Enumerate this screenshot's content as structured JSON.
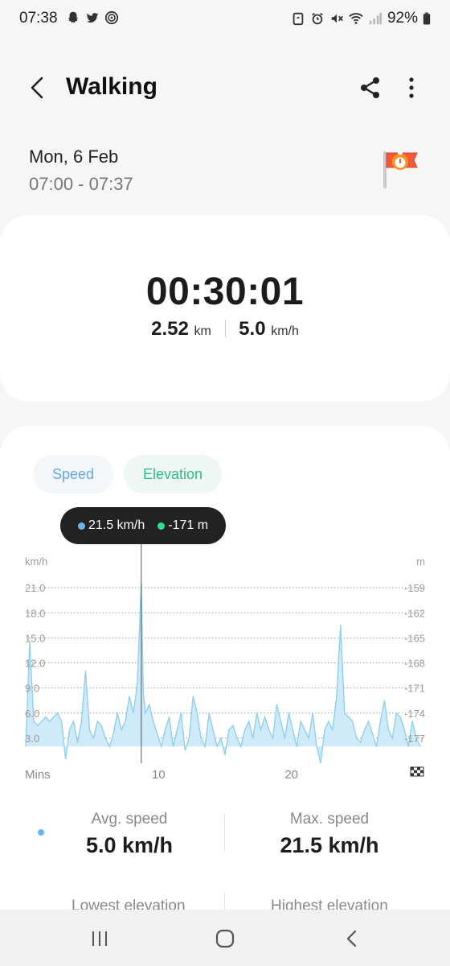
{
  "status_bar": {
    "time": "07:38",
    "battery": "92%",
    "left_icons": [
      "snapchat-icon",
      "twitter-icon",
      "nfc-icon"
    ],
    "right_icons": [
      "recycle-icon",
      "alarm-icon",
      "mute-icon",
      "wifi-icon",
      "signal-icon",
      "battery-icon"
    ]
  },
  "app_bar": {
    "title": "Walking"
  },
  "session": {
    "date": "Mon, 6 Feb",
    "time_range": "07:00 - 07:37"
  },
  "summary": {
    "duration": "00:30:01",
    "distance_value": "2.52",
    "distance_unit": "km",
    "speed_value": "5.0",
    "speed_unit": "km/h"
  },
  "chart_tabs": {
    "speed": "Speed",
    "elevation": "Elevation"
  },
  "tooltip": {
    "speed": "21.5 km/h",
    "elevation": "-171 m"
  },
  "colors": {
    "speed": "#6ab4ef",
    "speed_fill": "#cfeaf8",
    "elevation": "#2fbd85",
    "card": "#ffffff",
    "background": "#f6f6f6"
  },
  "chart_data": {
    "type": "area",
    "title": "",
    "left_axis_label": "km/h",
    "right_axis_label": "m",
    "left_ticks": [
      "21.0",
      "18.0",
      "15.0",
      "12.0",
      "9.0",
      "6.0",
      "3.0"
    ],
    "right_ticks": [
      "-159",
      "-162",
      "-165",
      "-168",
      "-171",
      "-174",
      "-177"
    ],
    "x_label": "Mins",
    "x_ticks": [
      "10",
      "20"
    ],
    "xlim": [
      0,
      30
    ],
    "ylim": [
      0,
      24
    ],
    "series": [
      {
        "values_x": [
          0,
          0.3,
          0.6,
          0.9,
          1.2,
          1.5,
          1.8,
          2.1,
          2.4,
          2.7,
          3.0,
          3.3,
          3.6,
          3.9,
          4.2,
          4.5,
          4.8,
          5.1,
          5.4,
          5.7,
          6.0,
          6.3,
          6.6,
          6.9,
          7.2,
          7.5,
          7.8,
          8.1,
          8.4,
          8.7,
          8.85,
          9.0,
          9.3,
          9.6,
          9.9,
          10.2,
          10.5,
          10.8,
          11.1,
          11.4,
          11.7,
          12.0,
          12.3,
          12.6,
          12.9,
          13.2,
          13.5,
          13.8,
          14.1,
          14.4,
          14.7,
          15.0,
          15.3,
          15.6,
          15.9,
          16.2,
          16.5,
          16.8,
          17.1,
          17.4,
          17.7,
          18.0,
          18.3,
          18.6,
          18.9,
          19.2,
          19.5,
          19.8,
          20.1,
          20.4,
          20.7,
          21.0,
          21.3,
          21.6,
          21.9,
          22.2,
          22.5,
          22.8,
          23.1,
          23.4,
          23.7,
          24.0,
          24.3,
          24.6,
          24.9,
          25.2,
          25.5,
          25.8,
          26.1,
          26.4,
          26.7,
          27.0,
          27.3,
          27.6,
          27.9,
          28.2,
          28.5,
          28.8,
          29.1,
          29.4,
          29.7,
          30.0
        ],
        "values_y": [
          2,
          14.5,
          5,
          4.5,
          5,
          5.5,
          5,
          5.5,
          6,
          5,
          0.5,
          4,
          5,
          2.5,
          5,
          11,
          4,
          3,
          5,
          4.5,
          3,
          2,
          3.5,
          6,
          4,
          5,
          8,
          6,
          9.5,
          21.5,
          8.5,
          6,
          7,
          5,
          3.5,
          2,
          4,
          5.5,
          2,
          4,
          6,
          1.5,
          3,
          8,
          6,
          3,
          2,
          6,
          4,
          2,
          3,
          1,
          4,
          4.5,
          3,
          2,
          4,
          5,
          3,
          6,
          4,
          5.5,
          4,
          3,
          7,
          5,
          3,
          6,
          4,
          2,
          5,
          4,
          3,
          6,
          2,
          0,
          4,
          5,
          4,
          8,
          16.5,
          6,
          5.5,
          5,
          3,
          2.5,
          4,
          5,
          3.5,
          2,
          5,
          7.5,
          4,
          3,
          6,
          5.5,
          4,
          2,
          5,
          3,
          2
        ]
      }
    ]
  },
  "metrics": {
    "avg_speed_label": "Avg. speed",
    "avg_speed_value": "5.0 km/h",
    "max_speed_label": "Max. speed",
    "max_speed_value": "21.5 km/h",
    "lowest_elevation_label": "Lowest elevation",
    "highest_elevation_label": "Highest elevation"
  },
  "nav_bar": {
    "recents": "recents-icon",
    "home": "home-icon",
    "back": "back-icon"
  }
}
